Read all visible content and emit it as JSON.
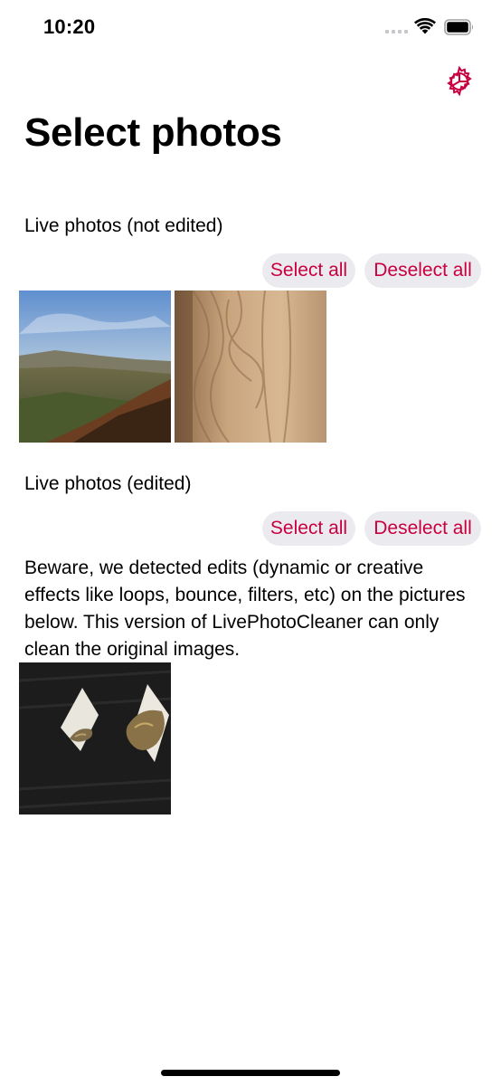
{
  "status_bar": {
    "time": "10:20"
  },
  "header": {
    "title": "Select photos",
    "settings_icon": "gear-icon"
  },
  "sections": [
    {
      "label": "Live photos (not edited)",
      "select_all": "Select all",
      "deselect_all": "Deselect all",
      "photos": [
        "landscape-photo",
        "wood-grain-photo"
      ]
    },
    {
      "label": "Live photos (edited)",
      "select_all": "Select all",
      "deselect_all": "Deselect all",
      "warning": "Beware, we detected edits (dynamic or creative effects like loops, bounce, filters, etc) on the pictures below. This version of LivePhotoCleaner can only clean the original images.",
      "photos": [
        "knit-fabric-photo"
      ]
    }
  ],
  "colors": {
    "accent": "#c8003f",
    "pill_background": "#ebebef"
  }
}
